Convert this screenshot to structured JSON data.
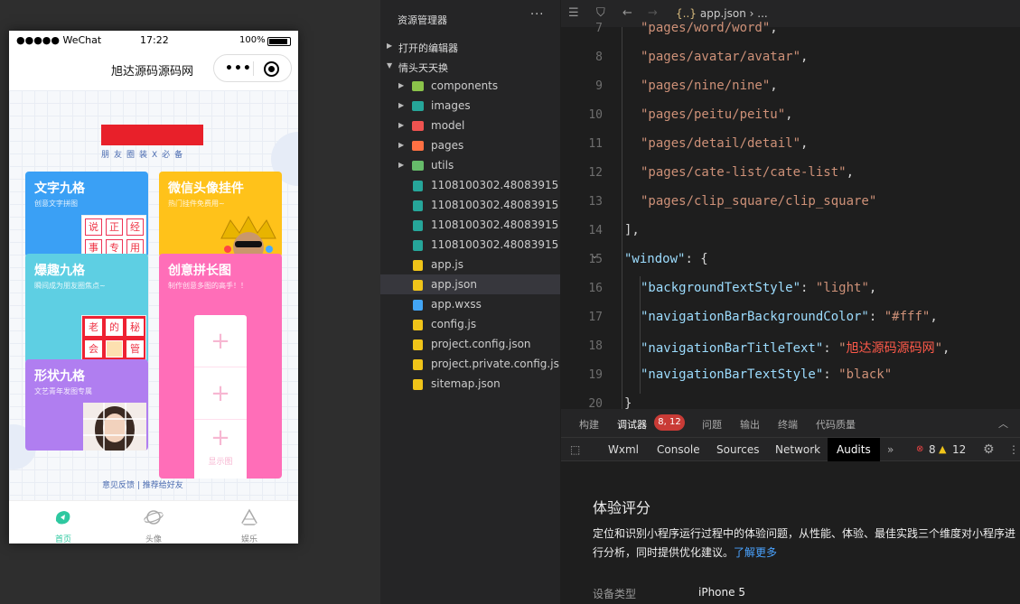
{
  "simulator": {
    "status": {
      "carrier": "●●●●● WeChat",
      "time": "17:22",
      "battery": "100%"
    },
    "nav_title": "旭达源码源码网",
    "logo_sub": "朋友圈装X必备",
    "cards": [
      {
        "title": "文字九格",
        "sub": "创意文字拼图",
        "chars": [
          "说",
          "正",
          "经",
          "事",
          "专",
          "用"
        ]
      },
      {
        "title": "微信头像挂件",
        "sub": "热门挂件免费用~"
      },
      {
        "title": "爆趣九格",
        "sub": "瞬间成为朋友圈焦点~",
        "chars": [
          "老",
          "的",
          "秘",
          "会",
          "",
          "管"
        ]
      },
      {
        "title": "创意拼长图",
        "sub": "制作创意多图的高手！！",
        "upload": "显示图"
      },
      {
        "title": "形状九格",
        "sub": "文艺青年发图专属"
      }
    ],
    "feedback": "意见反馈  |  推荐给好友",
    "tabs": [
      {
        "label": "首页",
        "color": "#2ec8a0"
      },
      {
        "label": "头像",
        "color": "#999999"
      },
      {
        "label": "娱乐",
        "color": "#999999"
      }
    ]
  },
  "explorer": {
    "title": "资源管理器",
    "more": "···",
    "sections": {
      "open_editors": "打开的编辑器",
      "project": "情头天天换"
    },
    "folders": [
      {
        "label": "components",
        "color": "#8bc34a"
      },
      {
        "label": "images",
        "color": "#26a69a"
      },
      {
        "label": "model",
        "color": "#ef5350"
      },
      {
        "label": "pages",
        "color": "#ff7043"
      },
      {
        "label": "utils",
        "color": "#66bb6a"
      }
    ],
    "files": [
      {
        "label": "1108100302.48083915...",
        "color": "#26a69a"
      },
      {
        "label": "1108100302.48083915...",
        "color": "#26a69a"
      },
      {
        "label": "1108100302.48083915...",
        "color": "#26a69a"
      },
      {
        "label": "1108100302.48083915...",
        "color": "#26a69a"
      },
      {
        "label": "app.js",
        "color": "#f0c419"
      },
      {
        "label": "app.json",
        "color": "#f0c419"
      },
      {
        "label": "app.wxss",
        "color": "#42a5f5"
      },
      {
        "label": "config.js",
        "color": "#f0c419"
      },
      {
        "label": "project.config.json",
        "color": "#f0c419"
      },
      {
        "label": "project.private.config.js...",
        "color": "#f0c419"
      },
      {
        "label": "sitemap.json",
        "color": "#f0c419"
      }
    ],
    "selected_file": "app.json"
  },
  "editor": {
    "breadcrumb_icon": "{..}",
    "breadcrumb": "app.json › ...",
    "lines": [
      {
        "n": "7",
        "parts": [
          {
            "t": "\"pages/word/word\"",
            "c": "str"
          },
          {
            "t": ",",
            "c": "pun"
          }
        ]
      },
      {
        "n": "8",
        "parts": [
          {
            "t": "\"pages/avatar/avatar\"",
            "c": "str"
          },
          {
            "t": ",",
            "c": "pun"
          }
        ]
      },
      {
        "n": "9",
        "parts": [
          {
            "t": "\"pages/nine/nine\"",
            "c": "str"
          },
          {
            "t": ",",
            "c": "pun"
          }
        ]
      },
      {
        "n": "10",
        "parts": [
          {
            "t": "\"pages/peitu/peitu\"",
            "c": "str"
          },
          {
            "t": ",",
            "c": "pun"
          }
        ]
      },
      {
        "n": "11",
        "parts": [
          {
            "t": "\"pages/detail/detail\"",
            "c": "str"
          },
          {
            "t": ",",
            "c": "pun"
          }
        ]
      },
      {
        "n": "12",
        "parts": [
          {
            "t": "\"pages/cate-list/cate-list\"",
            "c": "str"
          },
          {
            "t": ",",
            "c": "pun"
          }
        ]
      },
      {
        "n": "13",
        "parts": [
          {
            "t": "\"pages/clip_square/clip_square\"",
            "c": "str"
          }
        ]
      },
      {
        "n": "14",
        "parts": [
          {
            "t": "],",
            "c": "pun"
          }
        ]
      },
      {
        "n": "15",
        "parts": [
          {
            "t": "\"window\"",
            "c": "key"
          },
          {
            "t": ": {",
            "c": "pun"
          }
        ]
      },
      {
        "n": "16",
        "parts": [
          {
            "t": "\"backgroundTextStyle\"",
            "c": "key"
          },
          {
            "t": ": ",
            "c": "pun"
          },
          {
            "t": "\"light\"",
            "c": "str"
          },
          {
            "t": ",",
            "c": "pun"
          }
        ]
      },
      {
        "n": "17",
        "parts": [
          {
            "t": "\"navigationBarBackgroundColor\"",
            "c": "key"
          },
          {
            "t": ": ",
            "c": "pun"
          },
          {
            "t": "\"#fff\"",
            "c": "str"
          },
          {
            "t": ",",
            "c": "pun"
          }
        ]
      },
      {
        "n": "18",
        "parts": [
          {
            "t": "\"navigationBarTitleText\"",
            "c": "key"
          },
          {
            "t": ": ",
            "c": "pun"
          },
          {
            "t": "\"",
            "c": "str"
          },
          {
            "t": "旭达源码源码网",
            "c": "cn"
          },
          {
            "t": "\"",
            "c": "str"
          },
          {
            "t": ",",
            "c": "pun"
          }
        ]
      },
      {
        "n": "19",
        "parts": [
          {
            "t": "\"navigationBarTextStyle\"",
            "c": "key"
          },
          {
            "t": ": ",
            "c": "pun"
          },
          {
            "t": "\"black\"",
            "c": "str"
          }
        ]
      },
      {
        "n": "20",
        "parts": [
          {
            "t": "}",
            "c": "pun"
          }
        ]
      }
    ]
  },
  "panel": {
    "tabs": [
      "构建",
      "调试器",
      "问题",
      "输出",
      "终端",
      "代码质量"
    ],
    "debugger_badge": "8, 12",
    "devtools_tabs": [
      "Wxml",
      "Console",
      "Sources",
      "Network",
      "Audits"
    ],
    "errors": "8",
    "warnings": "12",
    "audit_title": "体验评分",
    "audit_desc": "定位和识别小程序运行过程中的体验问题，从性能、体验、最佳实践三个维度对小程序进行分析，同时提供优化建议。",
    "learn_more": "了解更多",
    "device_label": "设备类型",
    "device_value": "iPhone 5"
  }
}
